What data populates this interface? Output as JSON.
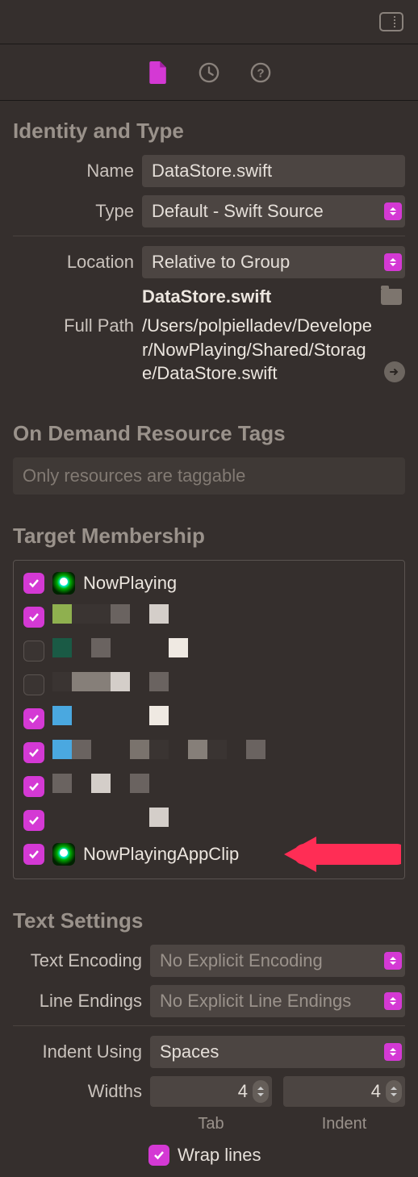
{
  "identity": {
    "title": "Identity and Type",
    "name_label": "Name",
    "name_value": "DataStore.swift",
    "type_label": "Type",
    "type_value": "Default - Swift Source",
    "location_label": "Location",
    "location_value": "Relative to Group",
    "file_display": "DataStore.swift",
    "fullpath_label": "Full Path",
    "fullpath_value": "/Users/polpielladev/Developer/NowPlaying/Shared/Storage/DataStore.swift"
  },
  "resource_tags": {
    "title": "On Demand Resource Tags",
    "placeholder": "Only resources are taggable"
  },
  "membership": {
    "title": "Target Membership",
    "targets": [
      {
        "checked": true,
        "label": "NowPlaying",
        "icon": "app"
      },
      {
        "checked": true,
        "label": "",
        "icon": "pixelated"
      },
      {
        "checked": false,
        "label": "",
        "icon": "pixelated"
      },
      {
        "checked": false,
        "label": "",
        "icon": "pixelated"
      },
      {
        "checked": true,
        "label": "",
        "icon": "pixelated"
      },
      {
        "checked": true,
        "label": "",
        "icon": "pixelated"
      },
      {
        "checked": true,
        "label": "",
        "icon": "pixelated"
      },
      {
        "checked": true,
        "label": "",
        "icon": "pixelated"
      },
      {
        "checked": true,
        "label": "NowPlayingAppClip",
        "icon": "app"
      }
    ]
  },
  "text_settings": {
    "title": "Text Settings",
    "encoding_label": "Text Encoding",
    "encoding_value": "No Explicit Encoding",
    "endings_label": "Line Endings",
    "endings_value": "No Explicit Line Endings",
    "indent_label": "Indent Using",
    "indent_value": "Spaces",
    "widths_label": "Widths",
    "tab_value": "4",
    "indent_width_value": "4",
    "tab_sublabel": "Tab",
    "indent_sublabel": "Indent",
    "wrap_label": "Wrap lines"
  }
}
